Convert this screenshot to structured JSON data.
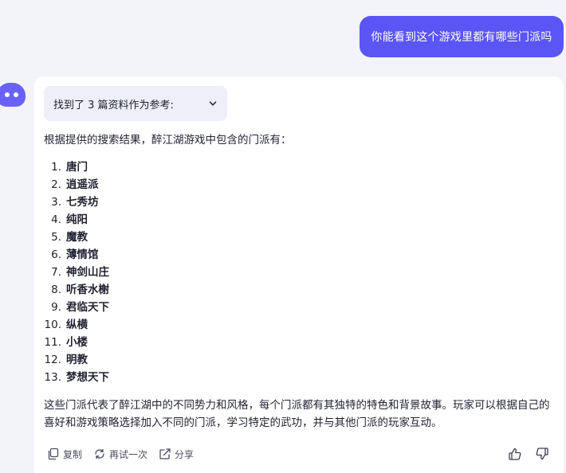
{
  "user_message": "你能看到这个游戏里都有哪些门派吗",
  "bot": {
    "references_label": "找到了 3 篇资料作为参考:",
    "intro": "根据提供的搜索结果，醉江湖游戏中包含的门派有：",
    "sects": [
      {
        "num": "1.",
        "name": "唐门"
      },
      {
        "num": "2.",
        "name": "逍遥派"
      },
      {
        "num": "3.",
        "name": "七秀坊"
      },
      {
        "num": "4.",
        "name": "纯阳"
      },
      {
        "num": "5.",
        "name": "魔教"
      },
      {
        "num": "6.",
        "name": "薄情馆"
      },
      {
        "num": "7.",
        "name": "神剑山庄"
      },
      {
        "num": "8.",
        "name": "听香水榭"
      },
      {
        "num": "9.",
        "name": "君临天下"
      },
      {
        "num": "10.",
        "name": "纵横"
      },
      {
        "num": "11.",
        "name": "小楼"
      },
      {
        "num": "12.",
        "name": "明教"
      },
      {
        "num": "13.",
        "name": "梦想天下"
      }
    ],
    "summary": "这些门派代表了醉江湖中的不同势力和风格，每个门派都有其独特的特色和背景故事。玩家可以根据自己的喜好和游戏策略选择加入不同的门派，学习特定的武功，并与其他门派的玩家互动。",
    "actions": {
      "copy": "复制",
      "retry": "再试一次",
      "share": "分享"
    }
  },
  "colors": {
    "accent": "#5b55f6",
    "avatar": "#6a62f7",
    "background": "#f3f4fa",
    "card": "#ffffff"
  }
}
